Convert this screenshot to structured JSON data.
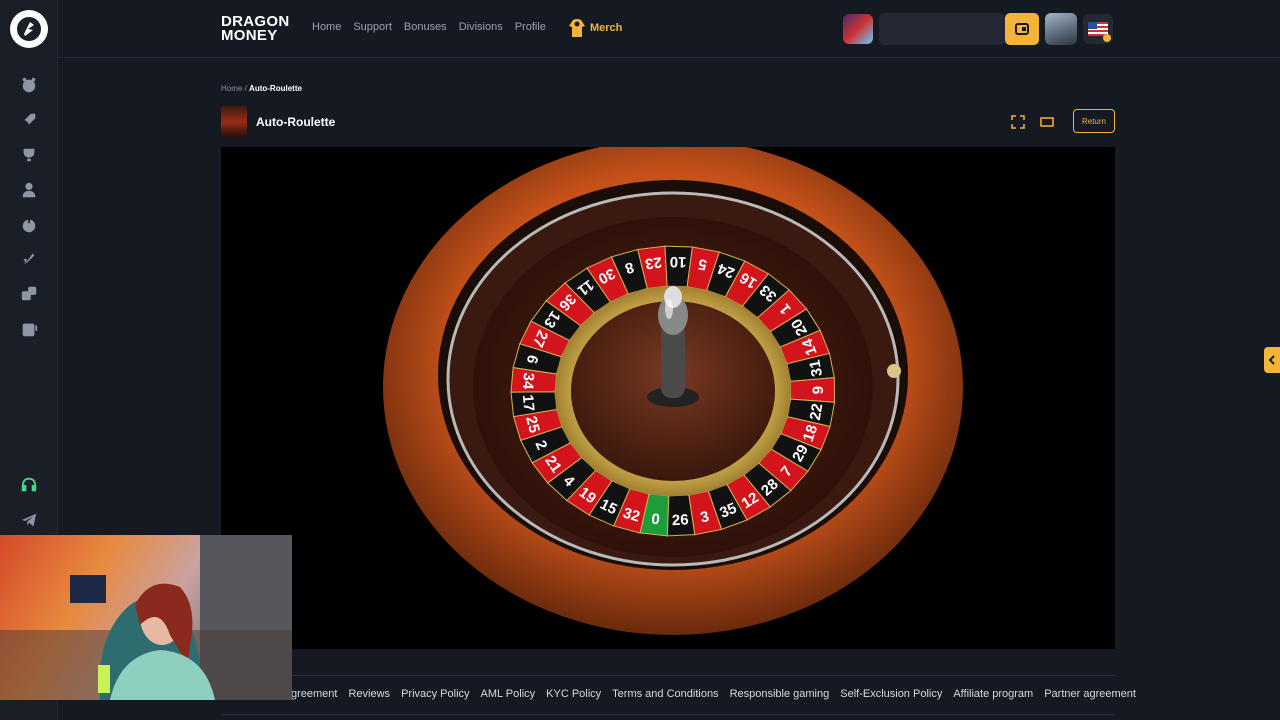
{
  "brand": {
    "line1": "DRAGON",
    "line2": "MONEY"
  },
  "nav": {
    "home": "Home",
    "support": "Support",
    "bonuses": "Bonuses",
    "divisions": "Divisions",
    "profile": "Profile",
    "merch": "Merch"
  },
  "breadcrumb": {
    "home": "Home",
    "separator": "/",
    "current": "Auto-Roulette"
  },
  "game": {
    "title": "Auto-Roulette",
    "return_label": "Return",
    "wheel_numbers": [
      "0",
      "32",
      "15",
      "19",
      "4",
      "21",
      "2",
      "25",
      "17",
      "34",
      "6",
      "27",
      "13",
      "36",
      "11",
      "30",
      "8",
      "23",
      "10",
      "5",
      "24",
      "16",
      "33",
      "1",
      "20",
      "14",
      "31",
      "9",
      "22",
      "18",
      "29",
      "7",
      "28",
      "12",
      "35",
      "3",
      "26"
    ]
  },
  "footer": {
    "links": [
      "greement",
      "Reviews",
      "Privacy Policy",
      "AML Policy",
      "KYC Policy",
      "Terms and Conditions",
      "Responsible gaming",
      "Self-Exclusion Policy",
      "Affiliate program",
      "Partner agreement"
    ]
  },
  "colors": {
    "accent": "#f4b43a",
    "background": "#151922",
    "sidebar": "#1a1e27",
    "support_green": "#3ddc84"
  }
}
